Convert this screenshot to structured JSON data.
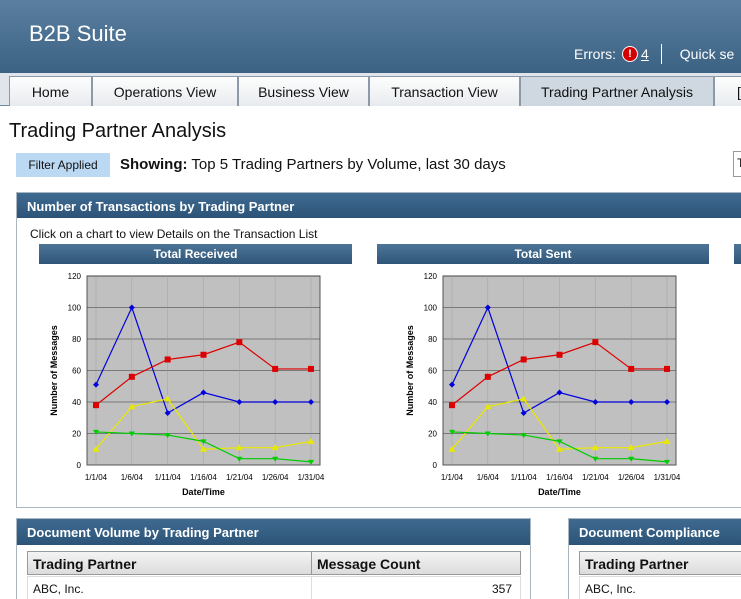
{
  "app": {
    "title": "B2B Suite",
    "errors_label": "Errors:",
    "errors_count": "4",
    "quick_search": "Quick se"
  },
  "tabs": [
    "Home",
    "Operations View",
    "Business View",
    "Transaction View",
    "Trading Partner Analysis",
    "["
  ],
  "page": {
    "title": "Trading Partner Analysis",
    "filter_badge": "Filter Applied",
    "showing_label": "Showing:",
    "showing_text": "Top 5 Trading Partners by Volume, last 30 days",
    "right_box": "T"
  },
  "transactions_panel": {
    "title": "Number of Transactions by Trading Partner",
    "hint": "Click on a chart to view Details on the Transaction List"
  },
  "chart_data": [
    {
      "type": "line",
      "title": "Total Received",
      "xlabel": "Date/Time",
      "ylabel": "Number of Messages",
      "ylim": [
        0,
        120
      ],
      "yticks": [
        0,
        20,
        40,
        60,
        80,
        100,
        120
      ],
      "x": [
        "1/1/04",
        "1/6/04",
        "1/11/04",
        "1/16/04",
        "1/21/04",
        "1/26/04",
        "1/31/04"
      ],
      "grid": true,
      "colors": {
        "blue": "#0000dd",
        "red": "#dd0000",
        "yellow": "#e8e800",
        "green": "#00cc00",
        "plot_bg": "#c0c0c0"
      },
      "series": [
        {
          "color": "#0000dd",
          "values": [
            51,
            100,
            33,
            46,
            40,
            40,
            40
          ]
        },
        {
          "color": "#dd0000",
          "values": [
            38,
            56,
            67,
            70,
            78,
            61,
            61
          ]
        },
        {
          "color": "#e8e800",
          "values": [
            10,
            37,
            42,
            10,
            11,
            11,
            15
          ]
        },
        {
          "color": "#00cc00",
          "values": [
            21,
            20,
            19,
            15,
            4,
            4,
            2
          ]
        }
      ]
    },
    {
      "type": "line",
      "title": "Total Sent",
      "xlabel": "Date/Time",
      "ylabel": "Number of Messages",
      "ylim": [
        0,
        120
      ],
      "yticks": [
        0,
        20,
        40,
        60,
        80,
        100,
        120
      ],
      "x": [
        "1/1/04",
        "1/6/04",
        "1/11/04",
        "1/16/04",
        "1/21/04",
        "1/26/04",
        "1/31/04"
      ],
      "grid": true,
      "colors": {
        "blue": "#0000dd",
        "red": "#dd0000",
        "yellow": "#e8e800",
        "green": "#00cc00",
        "plot_bg": "#c0c0c0"
      },
      "series": [
        {
          "color": "#0000dd",
          "values": [
            51,
            100,
            33,
            46,
            40,
            40,
            40
          ]
        },
        {
          "color": "#dd0000",
          "values": [
            38,
            56,
            67,
            70,
            78,
            61,
            61
          ]
        },
        {
          "color": "#e8e800",
          "values": [
            10,
            37,
            42,
            10,
            11,
            11,
            15
          ]
        },
        {
          "color": "#00cc00",
          "values": [
            21,
            20,
            19,
            15,
            4,
            4,
            2
          ]
        }
      ]
    }
  ],
  "volume_panel": {
    "title": "Document Volume by Trading Partner",
    "col1": "Trading Partner",
    "col2": "Message Count",
    "rows": [
      {
        "partner": "ABC, Inc.",
        "count": "357"
      }
    ]
  },
  "compliance_panel": {
    "title": "Document Compliance",
    "col1": "Trading Partner",
    "rows": [
      {
        "partner": "ABC, Inc."
      }
    ]
  }
}
